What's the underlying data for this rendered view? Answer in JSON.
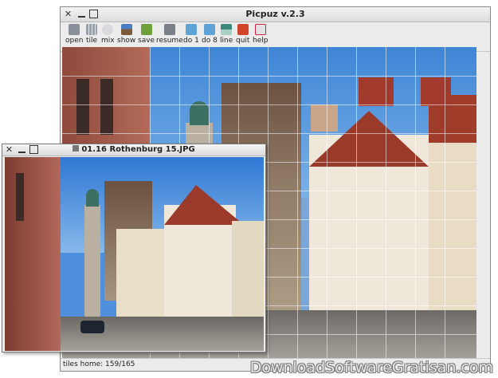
{
  "main_window": {
    "title": "Picpuz v.2.3",
    "toolbar": [
      {
        "label": "open",
        "icon": "open-folder-icon",
        "color": "#8a8f99"
      },
      {
        "label": "tile",
        "icon": "tile-grid-icon",
        "color": "#9aa0a8"
      },
      {
        "label": "mix",
        "icon": "mix-refresh-icon",
        "color": "#b8bcc4"
      },
      {
        "label": "show",
        "icon": "show-image-icon",
        "color": "#7f5a3a"
      },
      {
        "label": "save",
        "icon": "save-icon",
        "color": "#6ea03a"
      },
      {
        "label": "resume",
        "icon": "resume-icon",
        "color": "#7a7f88"
      },
      {
        "label": "do 1",
        "icon": "do-one-icon",
        "color": "#5fa2d6"
      },
      {
        "label": "do 8",
        "icon": "do-eight-icon",
        "color": "#5fa2d6"
      },
      {
        "label": "line",
        "icon": "line-icon",
        "color": "#3e8a7a"
      },
      {
        "label": "quit",
        "icon": "quit-icon",
        "color": "#d0452a"
      },
      {
        "label": "help",
        "icon": "help-icon",
        "color": "#c9c9c9"
      }
    ],
    "status": "tiles home: 159/165"
  },
  "viewer_window": {
    "title": "01.16 Rothenburg 15.JPG"
  },
  "watermark": "DownloadSoftwareGratisan.com"
}
